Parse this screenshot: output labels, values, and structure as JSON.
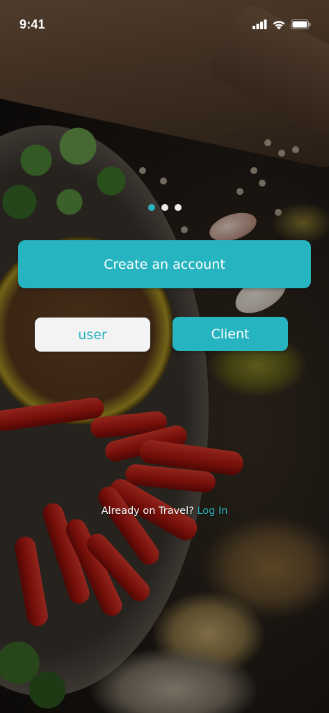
{
  "status_bar": {
    "time": "9:41",
    "icons": [
      "cellular-signal-icon",
      "wifi-icon",
      "battery-icon"
    ]
  },
  "onboarding": {
    "page_count": 3,
    "active_page": 1
  },
  "actions": {
    "create_account_label": "Create an account",
    "user_label": "user",
    "client_label": "Client"
  },
  "login": {
    "prompt": "Already on Travel?",
    "link_label": "Log In"
  },
  "colors": {
    "accent": "#25b4c0",
    "secondary_button": "#f3f3f3",
    "text_light": "#ffffff"
  }
}
